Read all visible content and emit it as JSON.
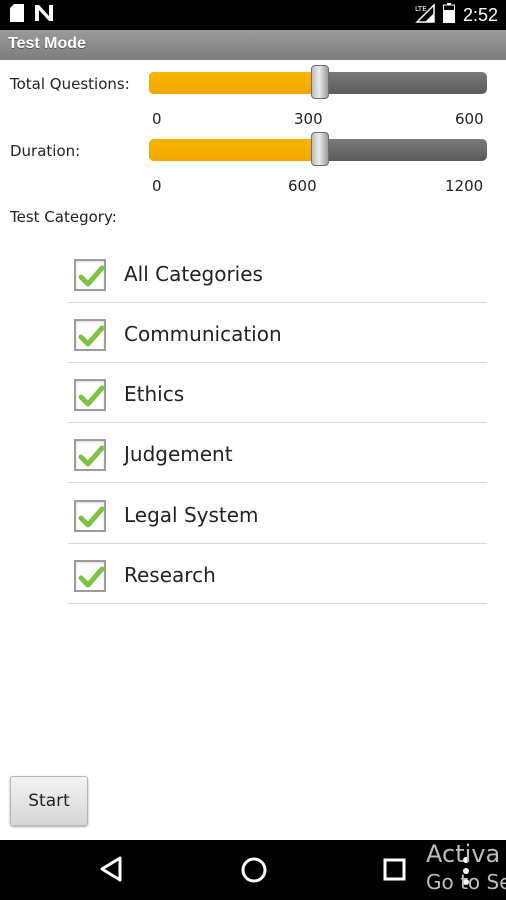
{
  "status_bar": {
    "time": "2:52",
    "icons": [
      "sd-card-icon",
      "n-notification-icon",
      "lte-signal-icon",
      "battery-icon"
    ]
  },
  "titlebar": {
    "title": "Test Mode"
  },
  "total_questions": {
    "label": "Total Questions:",
    "min": "0",
    "mid": "300",
    "max": "600",
    "value": 300,
    "range": [
      0,
      600
    ],
    "accent": "#f7b500"
  },
  "duration": {
    "label": "Duration:",
    "min": "0",
    "mid": "600",
    "max": "1200",
    "value": 600,
    "range": [
      0,
      1200
    ],
    "accent": "#f7b500"
  },
  "category": {
    "label": "Test Category:",
    "items": [
      {
        "label": "All Categories",
        "checked": true
      },
      {
        "label": "Communication",
        "checked": true
      },
      {
        "label": "Ethics",
        "checked": true
      },
      {
        "label": "Judgement",
        "checked": true
      },
      {
        "label": "Legal System",
        "checked": true
      },
      {
        "label": "Research",
        "checked": true
      }
    ],
    "check_color": "#7dc242"
  },
  "start_button": {
    "label": "Start"
  },
  "nav_bar": {
    "icons": [
      "back-icon",
      "home-icon",
      "recents-icon",
      "overflow-menu-icon"
    ]
  },
  "watermark": {
    "line1": "Activa",
    "line2": "Go to Se"
  }
}
